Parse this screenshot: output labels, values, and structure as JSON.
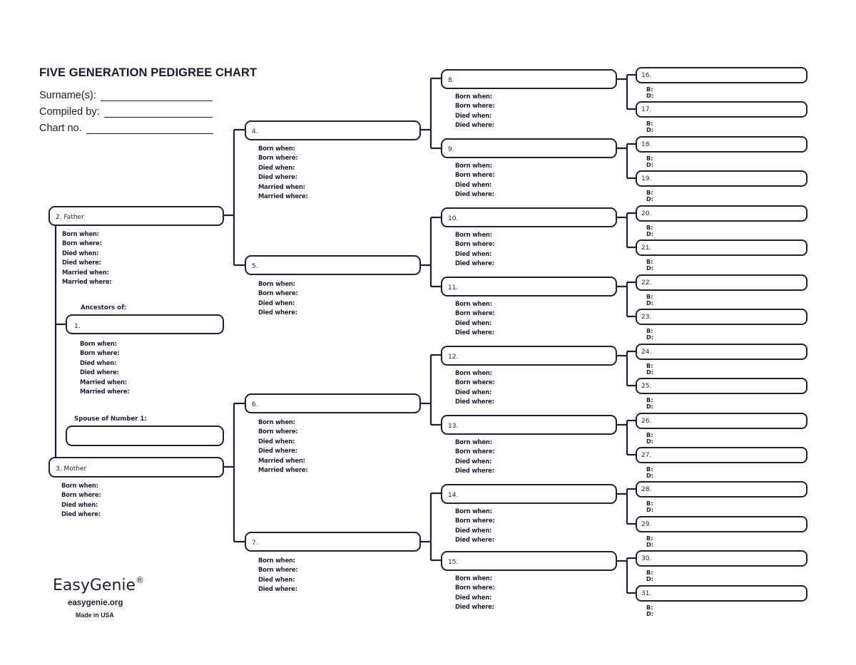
{
  "header": {
    "title": "FIVE GENERATION PEDIGREE CHART",
    "surname_label": "Surname(s):",
    "compiled_label": "Compiled by:",
    "chart_no_label": "Chart no.",
    "surname_value": "",
    "compiled_value": "",
    "chart_no_value": ""
  },
  "labels": {
    "born_when": "Born when:",
    "born_where": "Born where:",
    "died_when": "Died when:",
    "died_where": "Died where:",
    "married_when": "Married when:",
    "married_where": "Married where:",
    "b": "B:",
    "d": "D:",
    "ancestors_of": "Ancestors of:",
    "spouse_of": "Spouse of Number 1:"
  },
  "people": {
    "p1": "1.",
    "p2": "2. Father",
    "p3": "3. Mother",
    "spouse": "",
    "p4": "4.",
    "p5": "5.",
    "p6": "6.",
    "p7": "7.",
    "p8": "8.",
    "p9": "9.",
    "p10": "10.",
    "p11": "11.",
    "p12": "12.",
    "p13": "13.",
    "p14": "14.",
    "p15": "15.",
    "p16": "16.",
    "p17": "17.",
    "p18": "18.",
    "p19": "19.",
    "p20": "20.",
    "p21": "21.",
    "p22": "22.",
    "p23": "23.",
    "p24": "24.",
    "p25": "25.",
    "p26": "26.",
    "p27": "27.",
    "p28": "28.",
    "p29": "29.",
    "p30": "30.",
    "p31": "31."
  },
  "footer": {
    "brand": "EasyGenie",
    "registered": "®",
    "website": "easygenie.org",
    "made_in": "Made in USA"
  },
  "colors": {
    "ink": "#1f1f36"
  }
}
